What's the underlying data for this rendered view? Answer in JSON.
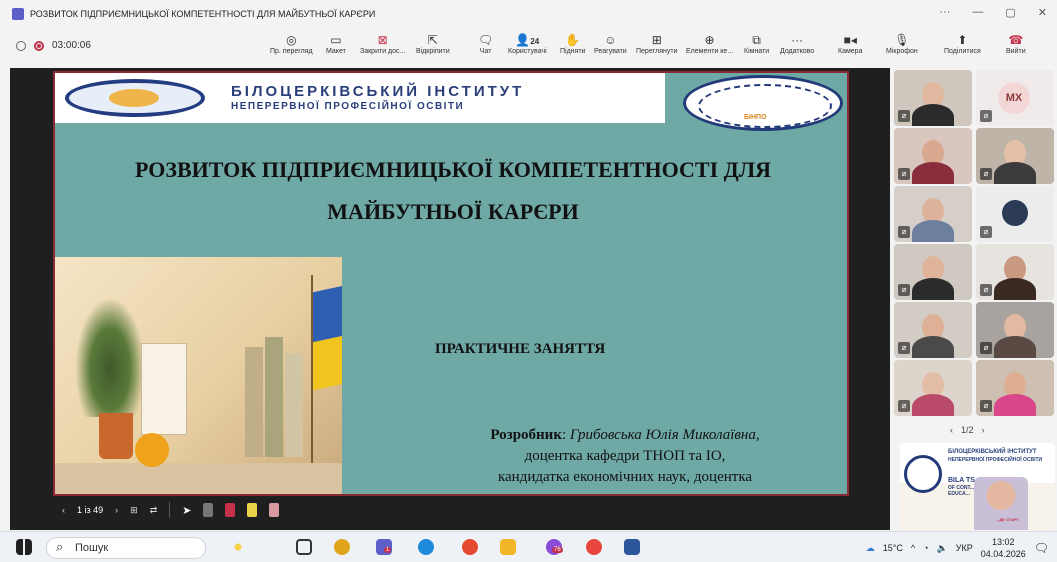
{
  "window": {
    "title": "РОЗВИТОК ПІДПРИЄМНИЦЬКОЇ КОМПЕТЕНТНОСТІ ДЛЯ МАЙБУТНЬОЇ КАРЄРИ",
    "controls": [
      "···",
      "—",
      "▢",
      "✕"
    ]
  },
  "meeting": {
    "timer": "03:00:06",
    "participants_count": "24",
    "toolbar": [
      {
        "label": "Пр. перегляд",
        "icon": "view-icon"
      },
      {
        "label": "Макет",
        "icon": "layout-icon"
      },
      {
        "label": "Закрити дос...",
        "icon": "stop-share-icon"
      },
      {
        "label": "Відкріпити",
        "icon": "unpin-icon"
      },
      {
        "label": "Чат",
        "icon": "chat-icon"
      },
      {
        "label": "Користувачі",
        "icon": "people-icon"
      },
      {
        "label": "Підняти",
        "icon": "raise-hand-icon"
      },
      {
        "label": "Реагувати",
        "icon": "react-icon"
      },
      {
        "label": "Переглянути",
        "icon": "view-grid-icon"
      },
      {
        "label": "Елементи ке...",
        "icon": "apps-icon"
      },
      {
        "label": "Кімнати",
        "icon": "rooms-icon"
      },
      {
        "label": "Додатково",
        "icon": "more-icon"
      },
      {
        "label": "Камера",
        "icon": "camera-icon"
      },
      {
        "label": "Мікрофон",
        "icon": "mic-icon"
      },
      {
        "label": "Поділитися",
        "icon": "share-icon"
      },
      {
        "label": "Вийти",
        "icon": "leave-icon"
      }
    ]
  },
  "slide": {
    "institute_line1": "БІЛОЦЕРКІВСЬКИЙ ІНСТИТУТ",
    "institute_line2": "НЕПЕРЕРВНОЇ ПРОФЕСІЙНОЇ ОСВІТИ",
    "seal_text": "БІНПО",
    "title_line1": "РОЗВИТОК ПІДПРИЄМНИЦЬКОЇ КОМПЕТЕНТНОСТІ ДЛЯ",
    "title_line2": "МАЙБУТНЬОЇ КАРЄРИ",
    "subtitle": "ПРАКТИЧНЕ ЗАНЯТТЯ",
    "developer_label": "Розробник",
    "developer_name": "Грибовська Юлія Миколаївна",
    "developer_line2": "доцентка кафедри ТНОП та ІО,",
    "developer_line3": "кандидатка економічних наук, доцентка",
    "colors": {
      "background": "#6fa9a6",
      "border": "#8b2a35"
    }
  },
  "slide_controls": {
    "page": "1 із 49"
  },
  "gallery": {
    "mx_initials": "MX",
    "pager": "1/2"
  },
  "share_thumb": {
    "line1": "БІЛОЦЕРКІВСЬКИЙ ІНСТИТУТ",
    "line2": "НЕПЕРЕРВНОЇ ПРОФЕСІЙНОЇ ОСВІТИ",
    "line3": "BILA TS... INSTITUTE",
    "line4": "OF CONT... PROFESSIONAL",
    "line5": "EDUCA...",
    "line6": "...ДЕ СТАРТ"
  },
  "taskbar": {
    "search_placeholder": "Пошук",
    "weather": "15°C",
    "lang": "УКР",
    "time": "13:02",
    "date": "04.04.2026",
    "badge_teams": "1",
    "badge_app": "76"
  }
}
